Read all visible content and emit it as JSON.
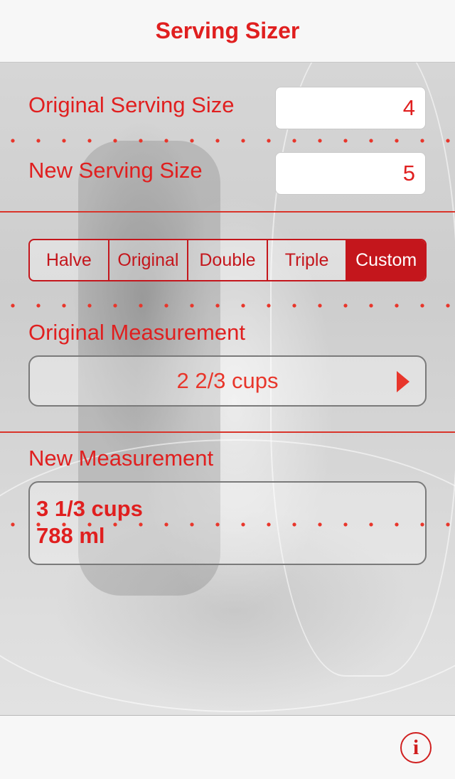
{
  "app": {
    "title": "Serving Sizer"
  },
  "servings": {
    "original_label": "Original Serving Size",
    "original_value": "4",
    "new_label": "New Serving Size",
    "new_value": "5"
  },
  "multiplier": {
    "options": [
      "Halve",
      "Original",
      "Double",
      "Triple",
      "Custom"
    ],
    "selected": "Custom"
  },
  "original_measurement": {
    "label": "Original Measurement",
    "value": "2 2/3 cups"
  },
  "new_measurement": {
    "label": "New Measurement",
    "line1": "3 1/3 cups",
    "line2": "788 ml"
  },
  "toolbar": {
    "info_icon": "info-icon"
  },
  "colors": {
    "accent": "#e01f1f",
    "segment_selected": "#c4161c",
    "divider": "#d9342a"
  }
}
